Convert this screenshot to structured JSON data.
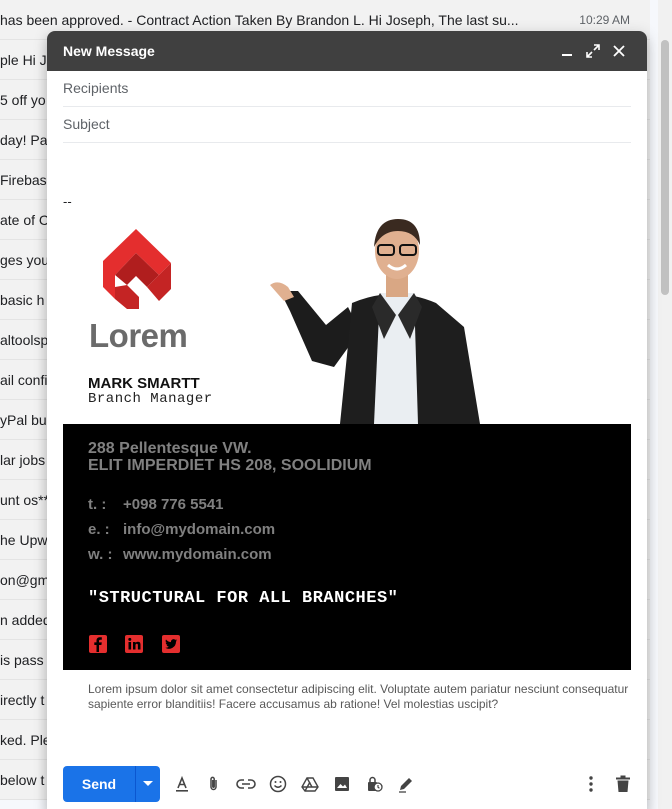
{
  "inbox": {
    "rows": [
      {
        "text": "has been approved. - Contract Action Taken By Brandon L. Hi Joseph, The last su...",
        "time": "10:29 AM"
      },
      {
        "text": "ple Hi Jo",
        "time": ""
      },
      {
        "text": "5 off yo",
        "time": ""
      },
      {
        "text": "day! Pa",
        "time": ""
      },
      {
        "text": "Firebas",
        "time": ""
      },
      {
        "text": "ate of C",
        "time": ""
      },
      {
        "text": "ges your",
        "time": ""
      },
      {
        "text": "basic h",
        "time": ""
      },
      {
        "text": "altoolsp",
        "time": ""
      },
      {
        "text": "ail confi",
        "time": ""
      },
      {
        "text": "yPal bu",
        "time": ""
      },
      {
        "text": "lar jobs",
        "time": ""
      },
      {
        "text": "unt os**",
        "time": ""
      },
      {
        "text": "he Upw",
        "time": ""
      },
      {
        "text": "on@gm",
        "time": ""
      },
      {
        "text": "n added",
        "time": ""
      },
      {
        "text": "is pass",
        "time": ""
      },
      {
        "text": "irectly t",
        "time": ""
      },
      {
        "text": "ked. Ple",
        "time": ""
      },
      {
        "text": "below t",
        "time": ""
      }
    ]
  },
  "compose": {
    "title": "New Message",
    "recipients_placeholder": "Recipients",
    "subject_placeholder": "Subject",
    "signature_separator": "--",
    "signature": {
      "brand": "Lorem",
      "name": "MARK SMARTT",
      "role": "Branch Manager",
      "address_line1": "288 Pellentesque VW.",
      "address_line2": "ELIT IMPERDIET HS 208, SOOLIDIUM",
      "phone_label": "t.  :",
      "phone": "+098 776 5541",
      "email_label": "e.  :",
      "email": "info@mydomain.com",
      "web_label": "w.  :",
      "web": "www.mydomain.com",
      "tagline": "\"STRUCTURAL FOR ALL BRANCHES\"",
      "accent_color": "#e42e2e"
    },
    "disclaimer": "Lorem ipsum dolor sit amet consectetur adipiscing elit. Voluptate autem pariatur nesciunt consequatur sapiente error blanditiis! Facere accusamus ab ratione! Vel molestias uscipit?",
    "send_label": "Send"
  }
}
